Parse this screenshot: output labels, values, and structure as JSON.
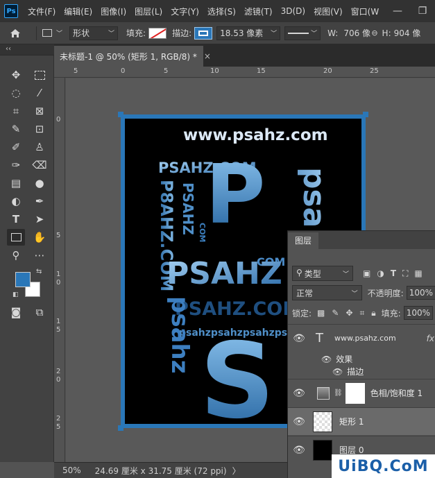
{
  "app": {
    "logo": "Ps"
  },
  "menu": [
    "文件(F)",
    "编辑(E)",
    "图像(I)",
    "图层(L)",
    "文字(Y)",
    "选择(S)",
    "滤镜(T)",
    "3D(D)",
    "视图(V)",
    "窗口(W"
  ],
  "options": {
    "mode": "形状",
    "fill_label": "填充:",
    "stroke_label": "描边:",
    "stroke_width": "18.53 像素",
    "w_label": "W:",
    "w_value": "706 像",
    "h_label": "H:",
    "h_value": "904 像"
  },
  "panel_collapse": "‹‹",
  "document": {
    "tab_title": "未标题-1 @ 50% (矩形 1, RGB/8) *",
    "close": "×"
  },
  "ruler": {
    "top": [
      "5",
      "0",
      "5",
      "10",
      "15",
      "20",
      "25"
    ],
    "left": [
      "0",
      "5",
      "1",
      "0",
      "1",
      "5",
      "2",
      "0",
      "2",
      "5"
    ]
  },
  "artwork": {
    "url": "www.psahz.com",
    "big_p": "P",
    "arc_top": "PSAHZ.COM",
    "word": "PSAHZ",
    "word2": "PSAHZ.COM",
    "com": "COM",
    "com_small": "COM",
    "repeat": "psahzpsahzpsahzpsahz",
    "big_s": "S",
    "vertical1": "P8AHZ.COM",
    "vertical2": "psahz",
    "vertical3": "PSAHZ",
    "vertical4": "psahz.com"
  },
  "status": {
    "zoom": "50%",
    "dims": "24.69 厘米 x 31.75 厘米 (72 ppi)",
    "arrow": "〉"
  },
  "layers": {
    "tab": "图层",
    "filter": "类型",
    "blend": "正常",
    "opacity_label": "不透明度:",
    "opacity": "100%",
    "lock_label": "锁定:",
    "fill_label": "填充:",
    "fill": "100%",
    "items": [
      {
        "name": "www.psahz.com",
        "fx": "fx"
      },
      {
        "name": "效果"
      },
      {
        "name": "描边"
      },
      {
        "name": "色相/饱和度 1"
      },
      {
        "name": "矩形 1"
      },
      {
        "name": "图层 0"
      }
    ]
  },
  "watermark": "UiBQ.CoM",
  "colors": {
    "accent": "#2a77b8",
    "foreground": "#2a77b8",
    "background": "#ffffff"
  }
}
